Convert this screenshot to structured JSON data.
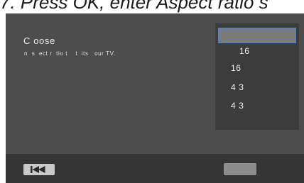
{
  "banner": {
    "text": "7. Press OK, enter Aspect ratio s"
  },
  "screen": {
    "heading": "C oose",
    "subtext": "n  s  ect r  tio t    t  its   our TV."
  },
  "aspect_list": {
    "items": [
      {
        "label": "16",
        "selected": true
      },
      {
        "label": "16",
        "selected": false
      },
      {
        "label": "4 3",
        "selected": false
      },
      {
        "label": "4 3",
        "selected": false
      }
    ]
  },
  "bottom_bar": {
    "prev_icon": "skip-back-icon",
    "right_button_label": ""
  },
  "colors": {
    "screen_bg": "#4d4d4d",
    "list_bg": "#3c3c3c",
    "selection_border": "#5a82b8",
    "bottom_bar_bg": "#353535"
  }
}
